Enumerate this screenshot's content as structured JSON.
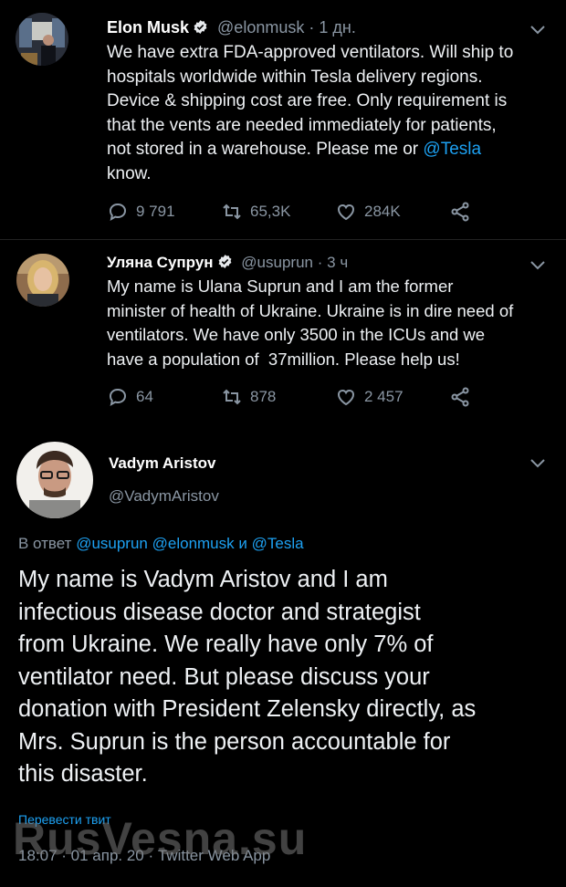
{
  "tweet1": {
    "name": "Elon Musk",
    "handle": "@elonmusk",
    "sep": "·",
    "time": "1 дн.",
    "lines": [
      "We have extra FDA-approved ventilators. Will ship to",
      "hospitals worldwide within Tesla delivery regions.",
      "Device & shipping cost are free. Only requirement is",
      "that the vents are needed immediately for patients,",
      "not stored in a warehouse. Please me or "
    ],
    "mention": "@Tesla",
    "last_line": "know.",
    "replies": "9 791",
    "retweets": "65,3K",
    "likes": "284K"
  },
  "tweet2": {
    "name": "Уляна Супрун",
    "handle": "@usuprun",
    "sep": "·",
    "time": "3 ч",
    "lines": [
      "My name is Ulana Suprun and I am the former",
      "minister of health of Ukraine. Ukraine is in dire need of",
      "ventilators. We have only 3500 in the ICUs and we",
      "have a population of  37million. Please help us!"
    ],
    "replies": "64",
    "retweets": "878",
    "likes": "2 457"
  },
  "tweet3": {
    "name": "Vadym Aristov",
    "handle": "@VadymAristov",
    "reply_prefix": "В ответ",
    "reply_mention1": "@usuprun",
    "reply_mention2": "@elonmusk",
    "reply_and": "и",
    "reply_mention3": "@Tesla",
    "lines": [
      "My name is Vadym Aristov and I am",
      "infectious disease doctor and strategist",
      "from Ukraine. We really have only 7% of",
      "ventilator need. But please discuss your",
      "donation with President Zelensky directly, as",
      "Mrs. Suprun is the person accountable for",
      "this disaster."
    ],
    "translate": "Перевести твит",
    "meta": "18:07 · 01 апр. 20 · Twitter Web App"
  },
  "watermark": "RusVesna.su",
  "colors": {
    "background": "#000000",
    "link": "#1da1f2",
    "muted": "#8a96a3",
    "text": "#eef1f4"
  },
  "icons": [
    "verified-badge-icon",
    "chevron-down-icon",
    "reply-icon",
    "retweet-icon",
    "like-icon",
    "share-icon"
  ]
}
